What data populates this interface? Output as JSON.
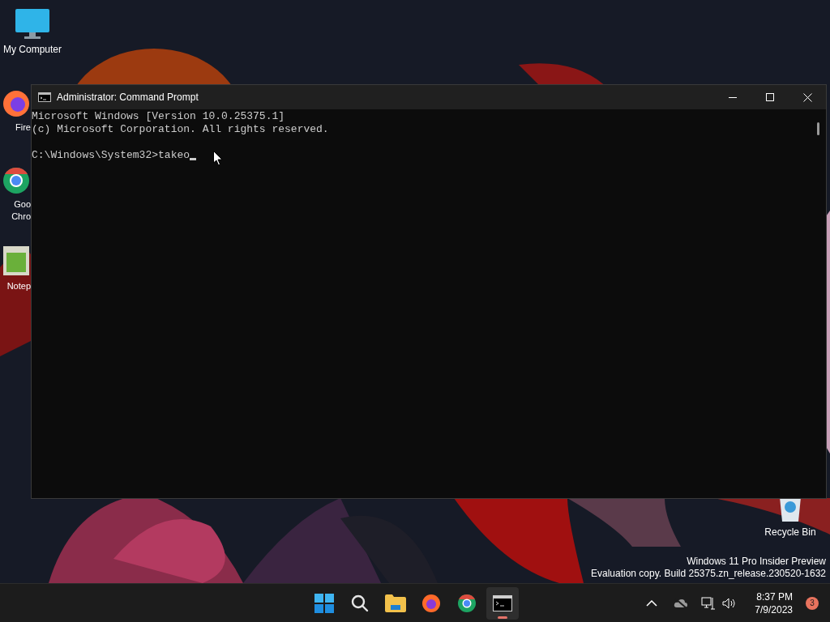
{
  "desktop_icons": [
    {
      "kind": "monitor",
      "lines": [
        "My Computer"
      ]
    },
    {
      "kind": "firefox",
      "lines": [
        "Fire"
      ]
    },
    {
      "kind": "chrome",
      "lines": [
        "Goo",
        "Chro"
      ]
    },
    {
      "kind": "notepad",
      "lines": [
        "Notep"
      ]
    },
    {
      "kind": "recycle",
      "lines": [
        "Recycle Bin"
      ]
    }
  ],
  "window": {
    "title": "Administrator: Command Prompt",
    "console_lines": [
      {
        "text": "Microsoft Windows [Version 10.0.25375.1]",
        "gap_before": false
      },
      {
        "text": "(c) Microsoft Corporation. All rights reserved.",
        "gap_before": false
      },
      {
        "text": "C:\\Windows\\System32>takeo",
        "gap_before": true
      }
    ],
    "cursor": true
  },
  "watermark": [
    "Windows 11 Pro Insider Preview",
    "Evaluation copy. Build 25375.zn_release.230520-1632"
  ],
  "taskbar": {
    "apps": [
      {
        "kind": "start",
        "selected": false
      },
      {
        "kind": "search",
        "selected": false
      },
      {
        "kind": "explorer",
        "selected": false
      },
      {
        "kind": "firefox",
        "selected": false
      },
      {
        "kind": "chrome",
        "selected": false
      },
      {
        "kind": "terminal",
        "selected": true
      }
    ],
    "clock": {
      "time": "8:37 PM",
      "date": "7/9/2023"
    },
    "notification_count": "3"
  }
}
